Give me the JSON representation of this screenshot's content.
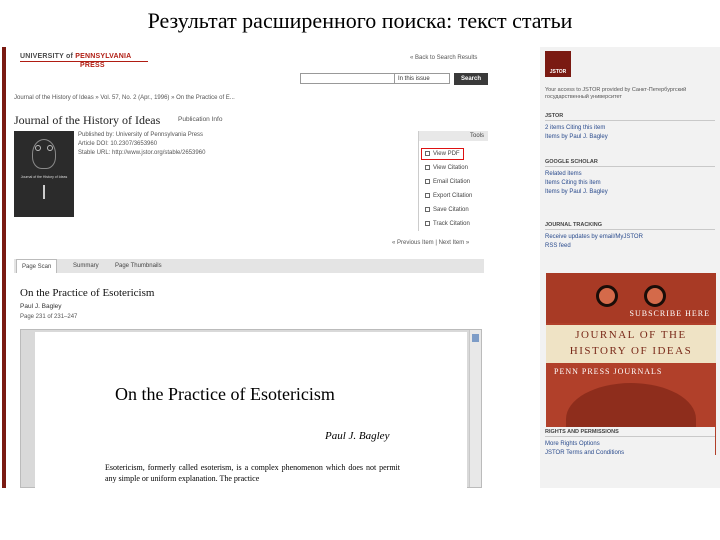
{
  "slide": {
    "title": "Результат расширенного поиска: текст статьи"
  },
  "header": {
    "logo_line1_a": "UNIVERSITY of",
    "logo_line1_b": "PENNSYLVANIA",
    "logo_line2": "PRESS",
    "back_link": "« Back to Search Results",
    "scope_value": "In this issue",
    "search_button": "Search"
  },
  "breadcrumb": "Journal of the History of Ideas  »  Vol. 57, No. 2 (Apr., 1996)  »  On the Practice of E...",
  "journal": {
    "title": "Journal of the History of Ideas",
    "pub_info_link": "Publication Info",
    "published_by": "Published by: University of Pennsylvania Press",
    "doi": "Article DOI: 10.2307/3653960",
    "stable_url": "Stable URL: http://www.jstor.org/stable/2653960"
  },
  "tools": {
    "header": "Tools",
    "items": [
      "View PDF",
      "View Citation",
      "Email Citation",
      "Export Citation",
      "Save Citation",
      "Track Citation"
    ]
  },
  "pager": {
    "prev_next": "« Previous Item  |  Next Item »"
  },
  "tabs": [
    "Page Scan",
    "Summary",
    "Page Thumbnails"
  ],
  "article": {
    "title": "On the Practice of Esotericism",
    "author": "Paul J. Bagley",
    "pages": "Page 231 of 231–247"
  },
  "page_scan": {
    "title": "On the Practice of Esotericism",
    "author": "Paul J. Bagley",
    "text": "Esotericism, formerly called esoterism, is a complex phenomenon which does not permit any simple or uniform explanation. The practice"
  },
  "sidebar": {
    "logo_text": "JSTOR",
    "access_text": "Your access to JSTOR provided by Санкт-Петербургский государственный университет",
    "sections": [
      {
        "heading": "JSTOR",
        "links": [
          "2 items Citing this item",
          "Items by Paul J. Bagley"
        ]
      },
      {
        "heading": "GOOGLE SCHOLAR",
        "links": [
          "Related items",
          "Items Citing this item",
          "Items by Paul J. Bagley"
        ]
      },
      {
        "heading": "JOURNAL TRACKING",
        "links": [
          "Receive updates by email/MyJSTOR",
          "RSS feed"
        ]
      },
      {
        "heading": "RIGHTS AND PERMISSIONS",
        "links": [
          "More Rights Options",
          "JSTOR Terms and Conditions"
        ]
      }
    ]
  },
  "ad": {
    "subscribe": "SUBSCRIBE HERE",
    "journal_line1": "JOURNAL OF THE",
    "journal_line2": "HISTORY OF IDEAS",
    "publisher": "PENN PRESS JOURNALS"
  }
}
